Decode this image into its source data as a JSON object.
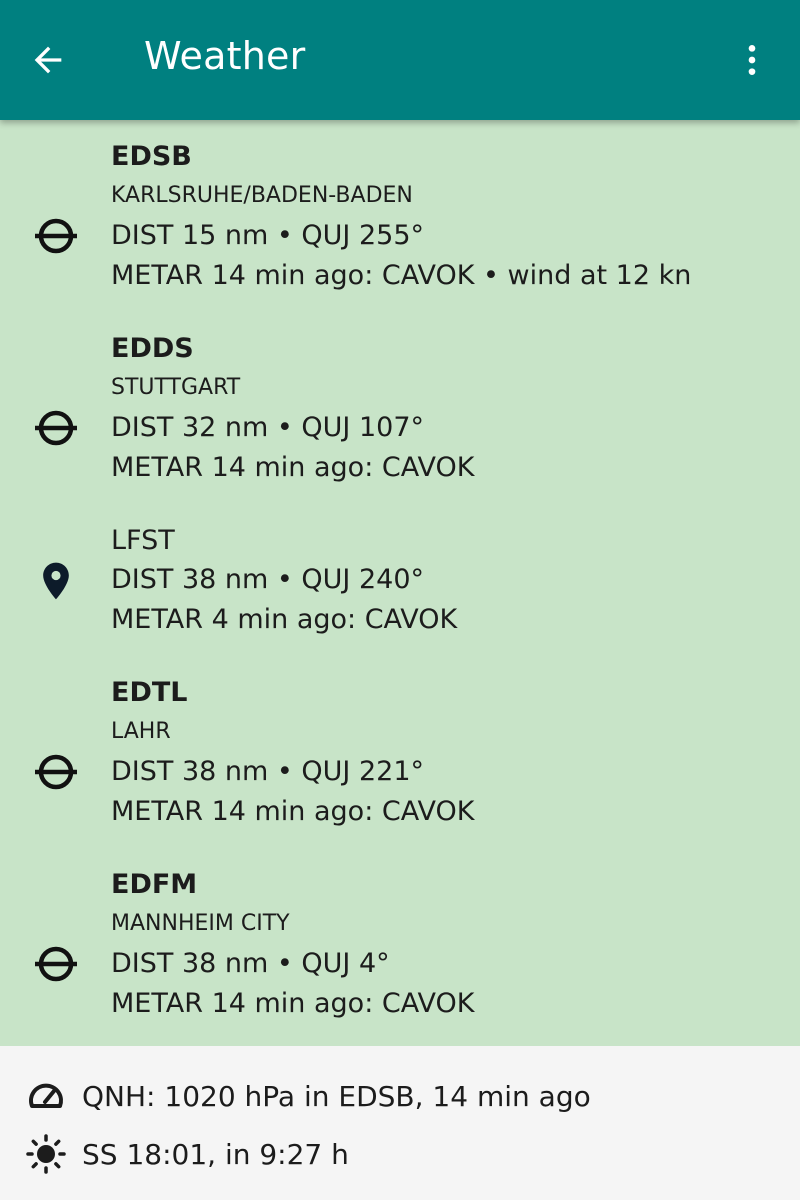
{
  "appbar": {
    "title": "Weather",
    "back_icon": "arrow-back-icon",
    "menu_icon": "more-vert-icon",
    "background": "#008080"
  },
  "stations": [
    {
      "code": "EDSB",
      "name": "KARLSRUHE/BADEN-BADEN",
      "icon": "airfield-icon",
      "dist": "DIST 15 nm • QUJ 255°",
      "metar": "METAR 14 min ago: CAVOK • wind at 12 kn"
    },
    {
      "code": "EDDS",
      "name": "STUTTGART",
      "icon": "airfield-icon",
      "dist": "DIST 32 nm • QUJ 107°",
      "metar": "METAR 14 min ago: CAVOK"
    },
    {
      "code": "LFST",
      "icon": "location-pin-icon",
      "dist": "DIST 38 nm • QUJ 240°",
      "metar": "METAR 4 min ago: CAVOK"
    },
    {
      "code": "EDTL",
      "name": "LAHR",
      "icon": "airfield-icon",
      "dist": "DIST 38 nm • QUJ 221°",
      "metar": "METAR 14 min ago: CAVOK"
    },
    {
      "code": "EDFM",
      "name": "MANNHEIM CITY",
      "icon": "airfield-icon",
      "dist": "DIST 38 nm • QUJ 4°",
      "metar": "METAR 14 min ago: CAVOK"
    }
  ],
  "footer": {
    "qnh": "QNH: 1020 hPa in EDSB, 14 min ago",
    "qnh_icon": "gauge-icon",
    "sunset": "SS 18:01, in 9:27 h",
    "sunset_icon": "sun-icon"
  },
  "colors": {
    "list_background": "#c8e4c8",
    "footer_background": "#f5f5f5"
  }
}
